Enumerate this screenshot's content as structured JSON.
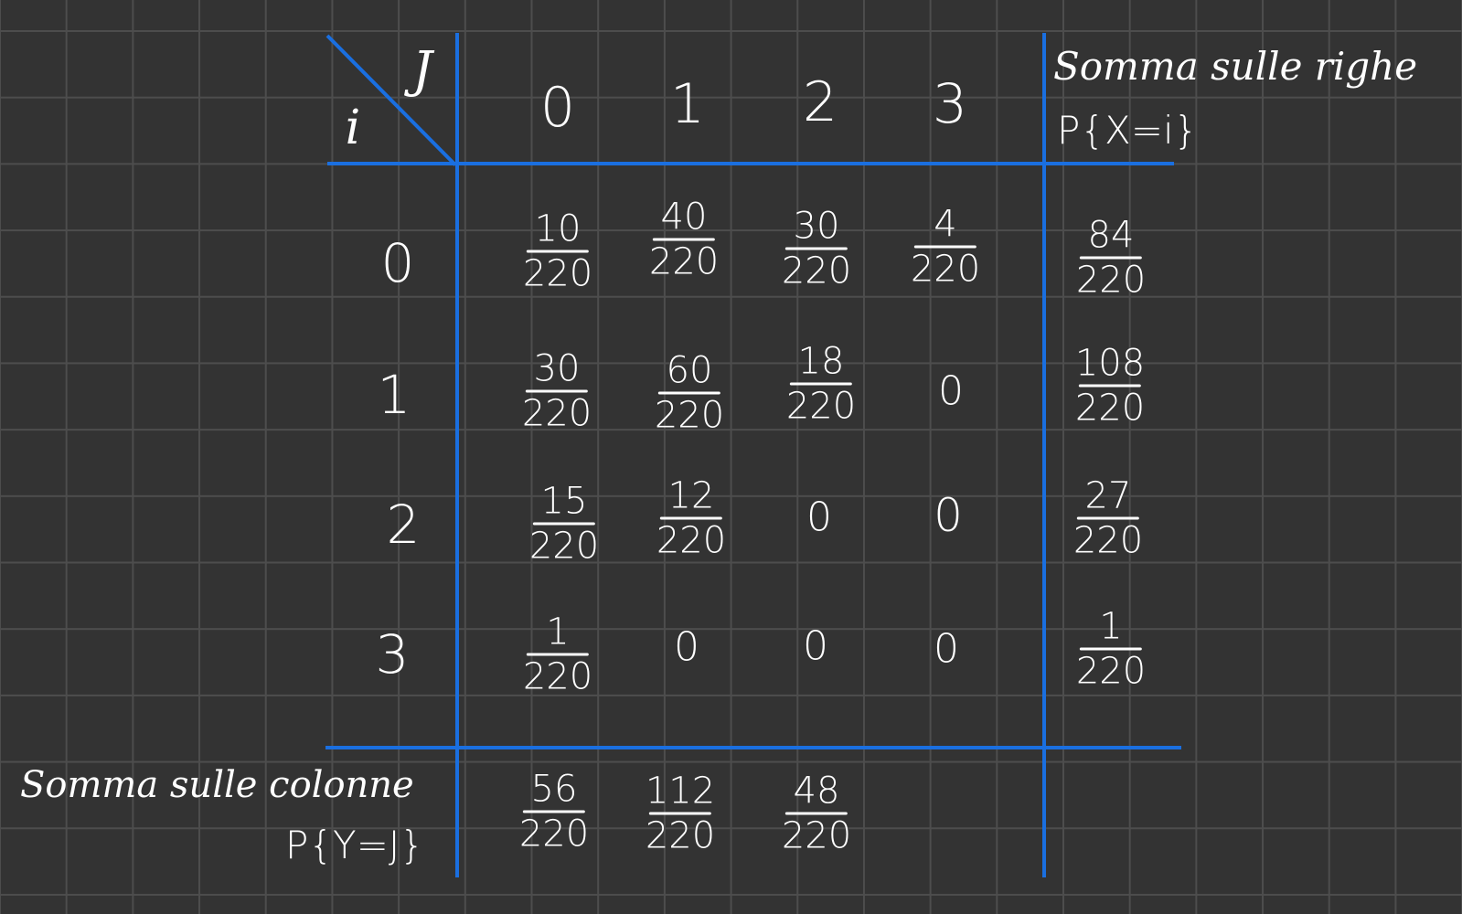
{
  "table": {
    "col_var": "J",
    "row_var": "i",
    "col_headers": [
      "0",
      "1",
      "2",
      "3"
    ],
    "row_headers": [
      "0",
      "1",
      "2",
      "3"
    ],
    "row_sum_title": "Somma sulle righe",
    "row_sum_formula": "P{X=i}",
    "col_sum_title": "Somma sulle colonne",
    "col_sum_formula": "P{Y=J}",
    "cells": [
      [
        {
          "num": "10",
          "den": "220"
        },
        {
          "num": "40",
          "den": "220"
        },
        {
          "num": "30",
          "den": "220"
        },
        {
          "num": "4",
          "den": "220"
        }
      ],
      [
        {
          "num": "30",
          "den": "220"
        },
        {
          "num": "60",
          "den": "220"
        },
        {
          "num": "18",
          "den": "220"
        },
        {
          "zero": "0"
        }
      ],
      [
        {
          "num": "15",
          "den": "220"
        },
        {
          "num": "12",
          "den": "220"
        },
        {
          "zero": "0"
        },
        {
          "zero": "0"
        }
      ],
      [
        {
          "num": "1",
          "den": "220"
        },
        {
          "zero": "0"
        },
        {
          "zero": "0"
        },
        {
          "zero": "0"
        }
      ]
    ],
    "row_sums": [
      {
        "num": "84",
        "den": "220"
      },
      {
        "num": "108",
        "den": "220"
      },
      {
        "num": "27",
        "den": "220"
      },
      {
        "num": "1",
        "den": "220"
      }
    ],
    "col_sums": [
      {
        "num": "56",
        "den": "220"
      },
      {
        "num": "112",
        "den": "220"
      },
      {
        "num": "48",
        "den": "220"
      }
    ]
  },
  "colors": {
    "background": "#333333",
    "grid": "#4d4d4d",
    "ink": "#ffffff",
    "table_lines": "#1a6fe0"
  }
}
